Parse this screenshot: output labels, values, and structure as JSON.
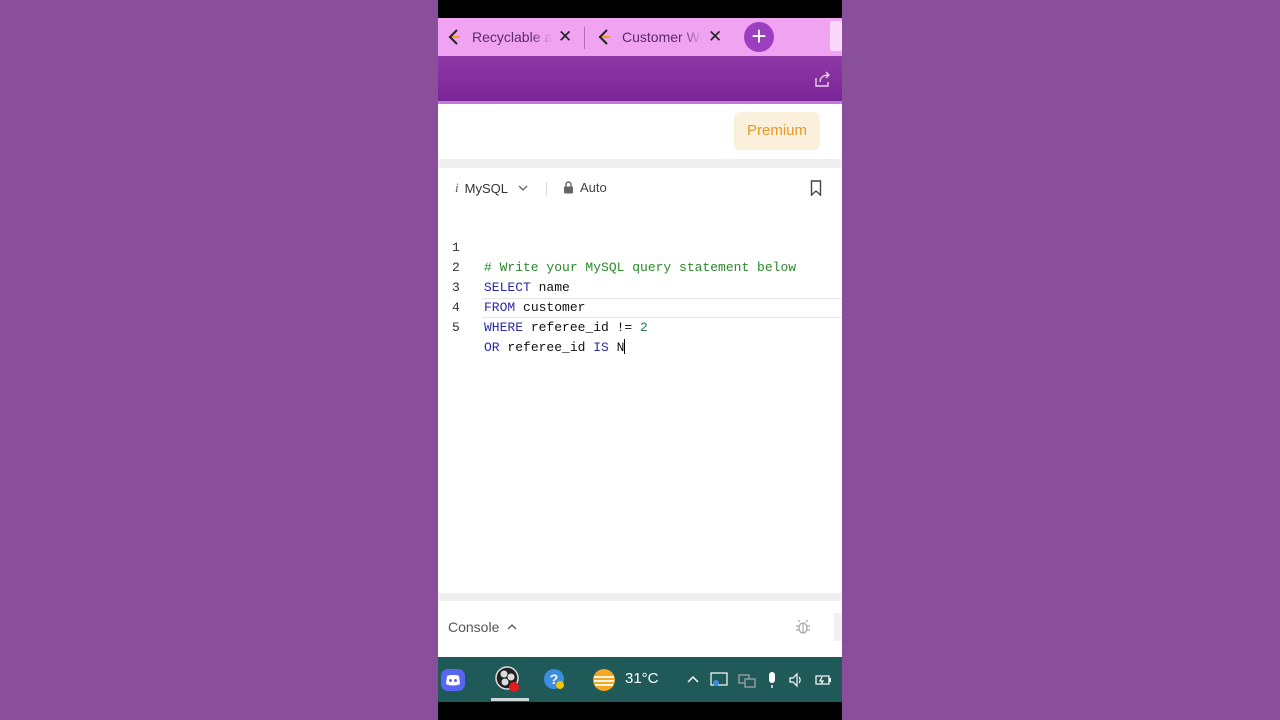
{
  "tabs": [
    {
      "title": "Recyclable and Low Fat Products",
      "close": "✕"
    },
    {
      "title": "Customer Who Never Order",
      "close": "✕"
    }
  ],
  "new_tab": "+",
  "header": {
    "premium_label": "Premium"
  },
  "editor": {
    "language_prefix": "i",
    "language": "MySQL",
    "mode": "Auto",
    "lines": [
      {
        "n": "1",
        "comment": "# Write your MySQL query statement below"
      },
      {
        "n": "2",
        "kw": "SELECT",
        "rest": " name"
      },
      {
        "n": "3",
        "kw": "FROM",
        "rest": " customer"
      },
      {
        "n": "4",
        "kw": "WHERE",
        "rest": " referee_id != ",
        "num": "2"
      },
      {
        "n": "5",
        "kw": "OR",
        "rest": " referee_id ",
        "kw2": "IS",
        "rest2": " N"
      }
    ]
  },
  "console": {
    "label": "Console"
  },
  "taskbar": {
    "temperature": "31°C"
  },
  "colors": {
    "background": "#8a4f9a",
    "tab_strip": "#f0a3f0",
    "toolbar": "#7a2597",
    "premium_text": "#e69a2a",
    "taskbar": "#1f5a58"
  },
  "icons": [
    "leetcode-favicon",
    "close-icon",
    "plus-icon",
    "share-icon",
    "lock-icon",
    "chevron-down-icon",
    "bookmark-icon",
    "chevron-up-icon",
    "bug-icon",
    "discord-icon",
    "obs-icon",
    "help-icon",
    "weather-icon",
    "chevron-up-tray-icon",
    "network-icon",
    "screen-icon",
    "mic-icon",
    "volume-icon",
    "battery-icon"
  ]
}
